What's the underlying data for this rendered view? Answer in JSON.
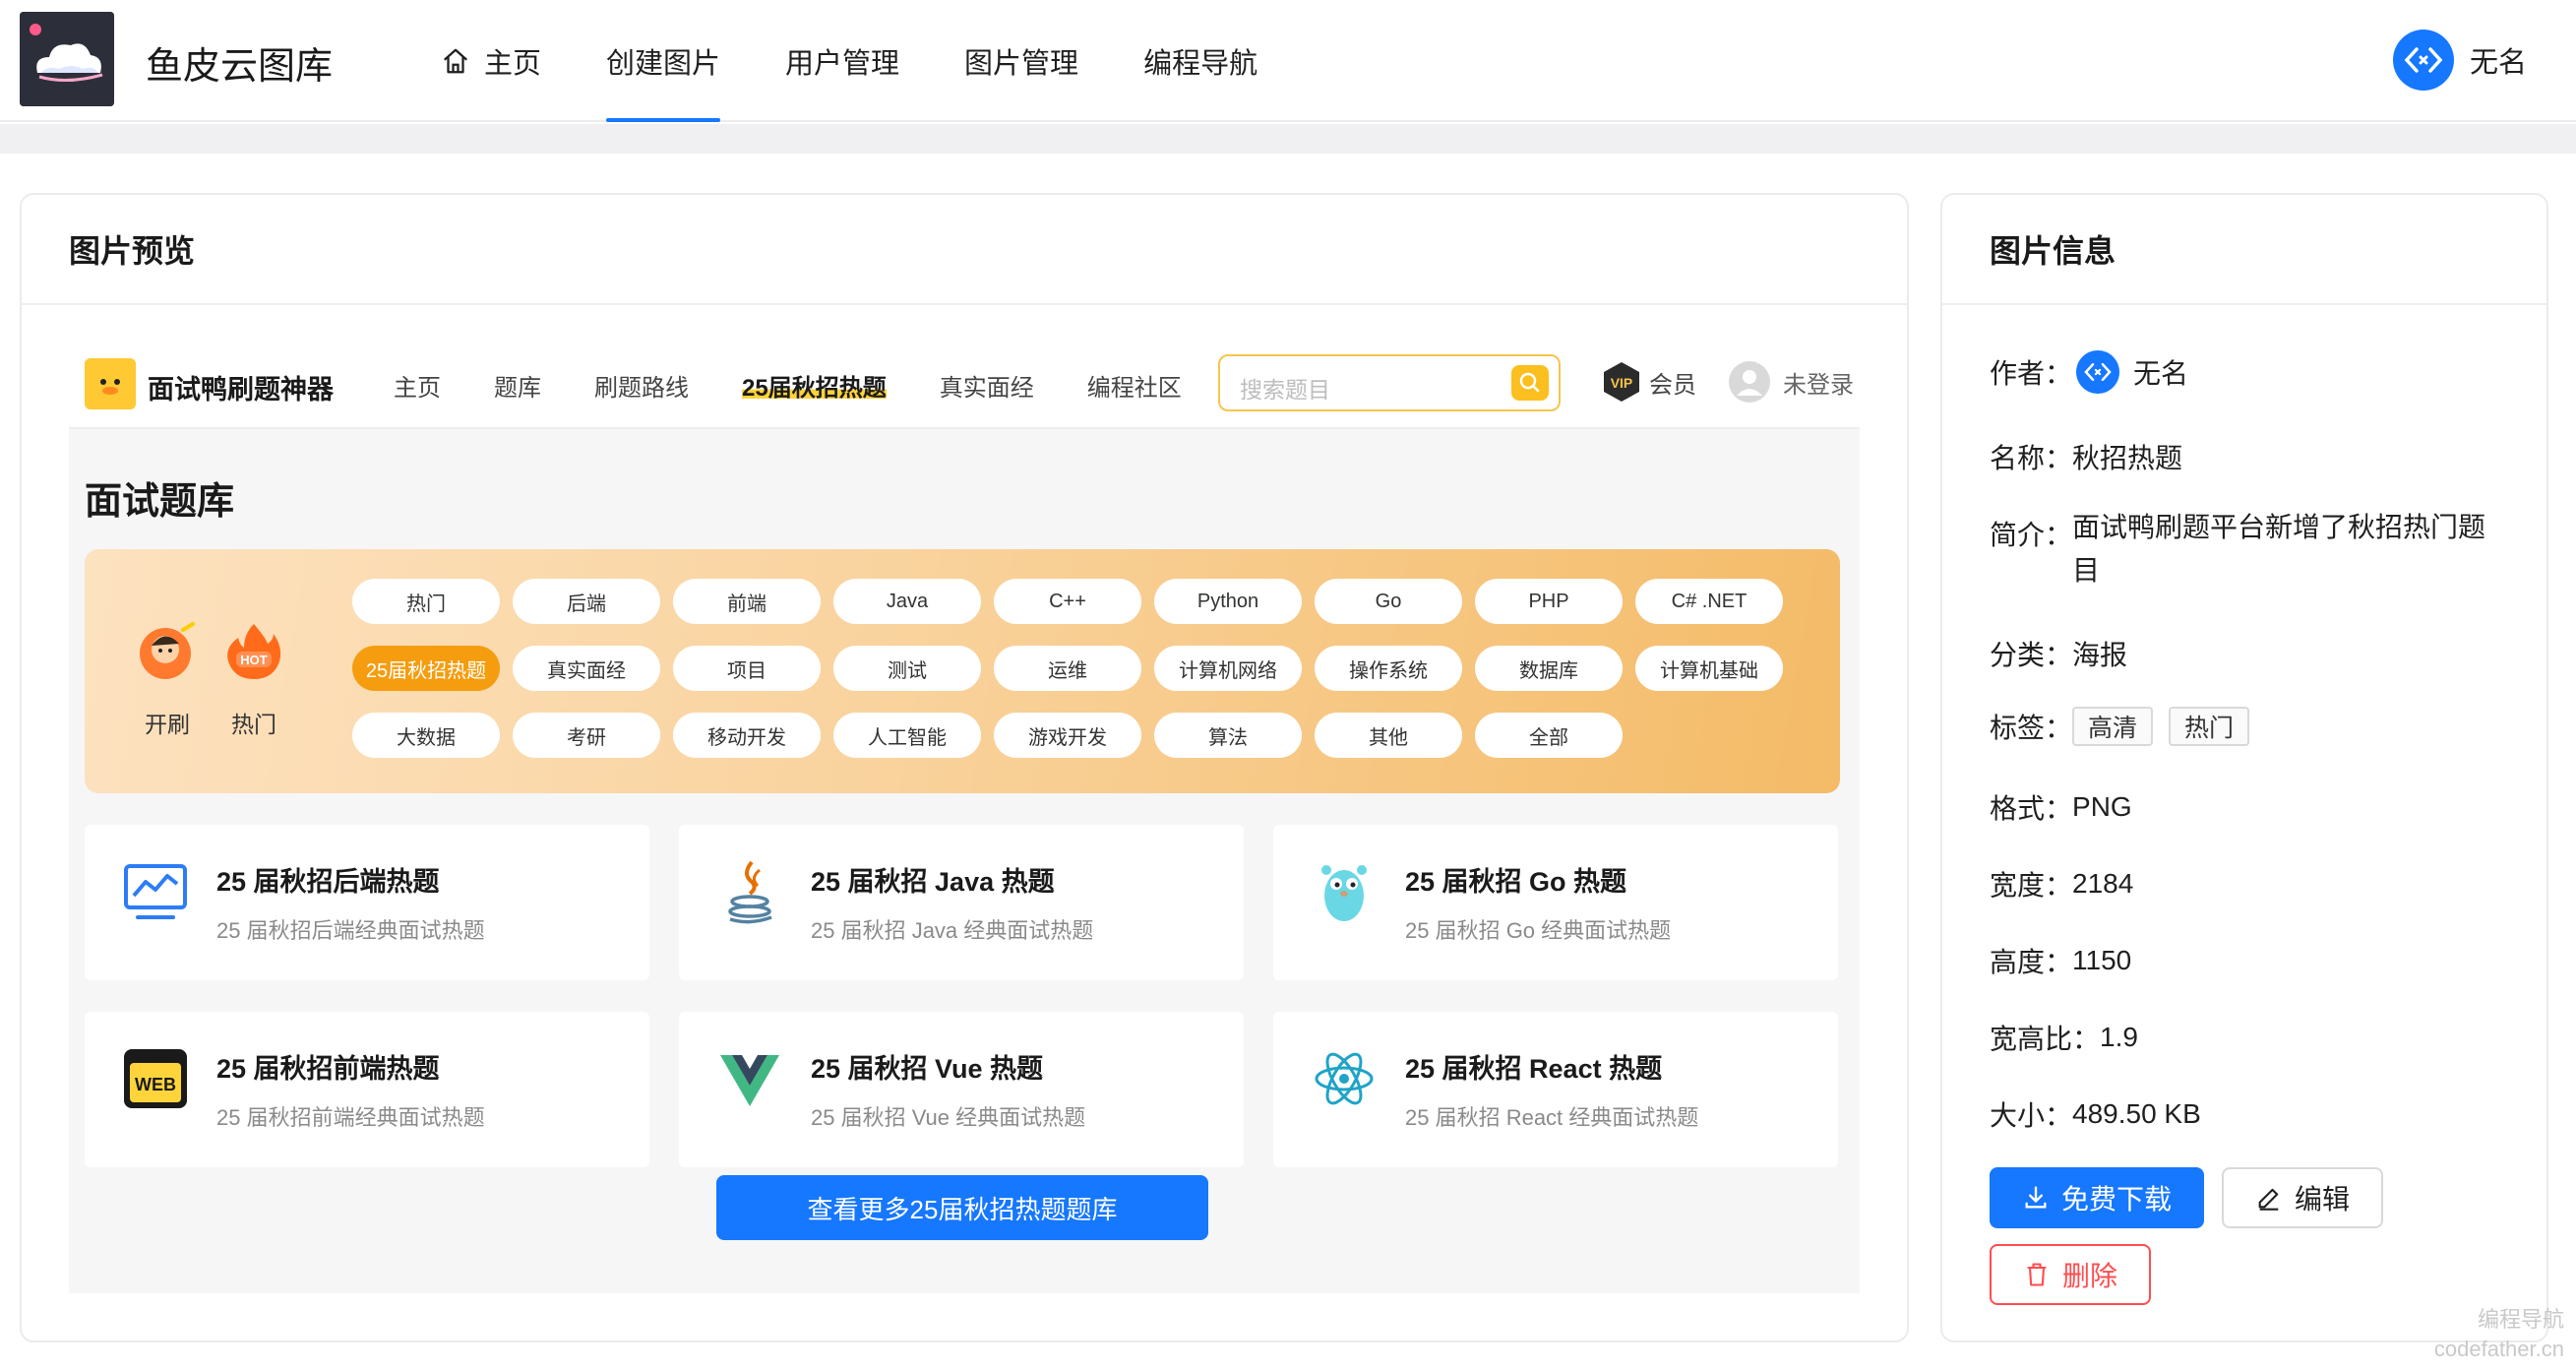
{
  "header": {
    "site_title": "鱼皮云图库",
    "nav": [
      {
        "label": "主页",
        "icon": "home-icon",
        "active": false
      },
      {
        "label": "创建图片",
        "active": true
      },
      {
        "label": "用户管理",
        "active": false
      },
      {
        "label": "图片管理",
        "active": false
      },
      {
        "label": "编程导航",
        "active": false
      }
    ],
    "user": {
      "name": "无名",
      "avatar_icon": "code-icon"
    }
  },
  "preview": {
    "title": "图片预览",
    "poster": {
      "brand": "面试鸭刷题神器",
      "nav": [
        "主页",
        "题库",
        "刷题路线",
        "25届秋招热题",
        "真实面经",
        "编程社区"
      ],
      "search_placeholder": "搜索题目",
      "vip_label": "会员",
      "login_label": "未登录",
      "heading": "面试题库",
      "quick": [
        {
          "label": "开刷",
          "icon": "character-icon"
        },
        {
          "label": "热门",
          "icon": "hot-fire-icon"
        }
      ],
      "tags": [
        [
          "热门",
          "后端",
          "前端",
          "Java",
          "C++",
          "Python",
          "Go",
          "PHP",
          "C# .NET"
        ],
        [
          "25届秋招热题",
          "真实面经",
          "项目",
          "测试",
          "运维",
          "计算机网络",
          "操作系统",
          "数据库",
          "计算机基础"
        ],
        [
          "大数据",
          "考研",
          "移动开发",
          "人工智能",
          "游戏开发",
          "算法",
          "其他",
          "全部"
        ]
      ],
      "courses": [
        {
          "title": "25 届秋招后端热题",
          "desc": "25 届秋招后端经典面试热题",
          "icon": "monitor-chart-icon"
        },
        {
          "title": "25 届秋招 Java 热题",
          "desc": "25 届秋招 Java 经典面试热题",
          "icon": "java-icon"
        },
        {
          "title": "25 届秋招 Go 热题",
          "desc": "25 届秋招 Go 经典面试热题",
          "icon": "go-gopher-icon"
        },
        {
          "title": "25 届秋招前端热题",
          "desc": "25 届秋招前端经典面试热题",
          "icon": "web-icon"
        },
        {
          "title": "25 届秋招 Vue 热题",
          "desc": "25 届秋招 Vue 经典面试热题",
          "icon": "vue-icon"
        },
        {
          "title": "25 届秋招 React 热题",
          "desc": "25 届秋招 React 经典面试热题",
          "icon": "react-icon"
        }
      ],
      "cta": "查看更多25届秋招热题题库"
    }
  },
  "info": {
    "title": "图片信息",
    "author_label": "作者：",
    "author": "无名",
    "name_label": "名称：",
    "name": "秋招热题",
    "intro_label": "简介：",
    "intro_line1": "面试鸭刷题平台新增了秋招热门题",
    "intro_line2": "目",
    "category_label": "分类：",
    "category": "海报",
    "tags_label": "标签：",
    "tags": [
      "高清",
      "热门"
    ],
    "format_label": "格式：",
    "format": "PNG",
    "width_label": "宽度：",
    "width": "2184",
    "height_label": "高度：",
    "height": "1150",
    "ratio_label": "宽高比：",
    "ratio": "1.9",
    "size_label": "大小：",
    "size": "489.50 KB",
    "download_label": "免费下载",
    "edit_label": "编辑",
    "delete_label": "删除"
  },
  "watermark": {
    "line1": "编程导航",
    "line2": "codefather.cn"
  },
  "colors": {
    "primary": "#1677ff",
    "danger": "#ff4d4f",
    "hot_tag": "#f59d0f",
    "brand_yellow": "#ffc933"
  }
}
